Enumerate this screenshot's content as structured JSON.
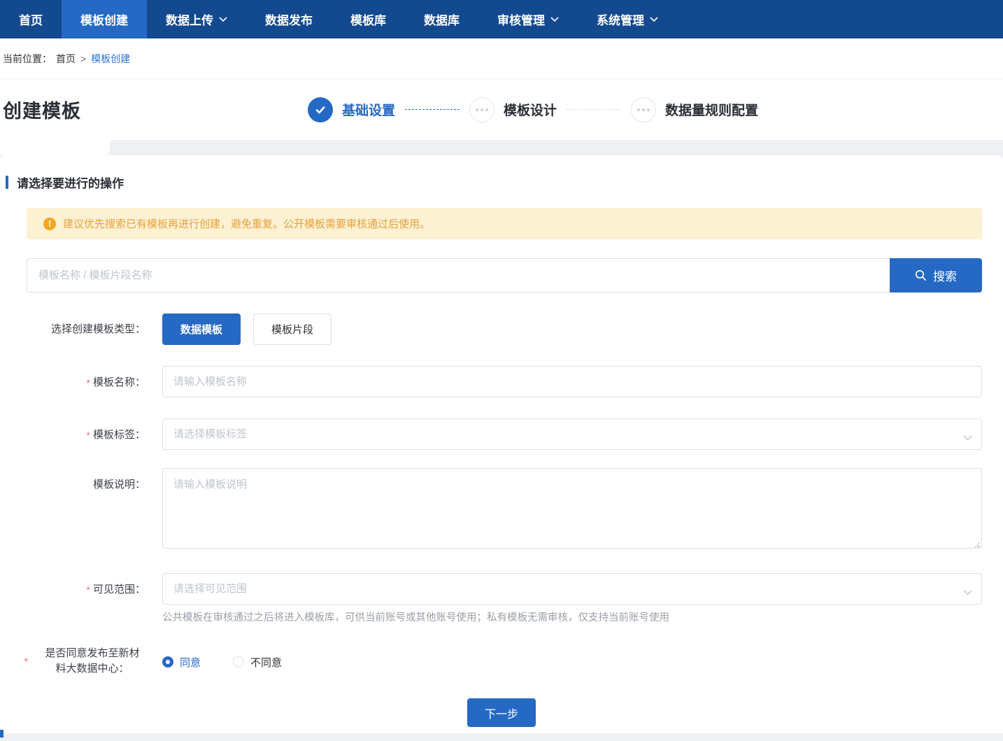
{
  "colors": {
    "nav_bg": "#13498F",
    "primary": "#2569C5",
    "link": "#2D74D4",
    "warning_bg": "#FCF1D3",
    "warning_text": "#E6A23C",
    "warning_icon": "#F5A623",
    "required": "#F56C6C"
  },
  "nav": {
    "items": [
      {
        "label": "首页",
        "active": false,
        "dropdown": false
      },
      {
        "label": "模板创建",
        "active": true,
        "dropdown": false
      },
      {
        "label": "数据上传",
        "active": false,
        "dropdown": true
      },
      {
        "label": "数据发布",
        "active": false,
        "dropdown": false
      },
      {
        "label": "模板库",
        "active": false,
        "dropdown": false
      },
      {
        "label": "数据库",
        "active": false,
        "dropdown": false
      },
      {
        "label": "审核管理",
        "active": false,
        "dropdown": true
      },
      {
        "label": "系统管理",
        "active": false,
        "dropdown": true
      }
    ]
  },
  "breadcrumb": {
    "prefix": "当前位置：",
    "home": "首页",
    "separator": ">",
    "current": "模板创建"
  },
  "header": {
    "title": "创建模板"
  },
  "stepper": {
    "steps": [
      {
        "label": "基础设置",
        "state": "active"
      },
      {
        "label": "模板设计",
        "state": "pending"
      },
      {
        "label": "数据量规则配置",
        "state": "pending"
      }
    ]
  },
  "section": {
    "title": "请选择要进行的操作"
  },
  "notice": {
    "icon": "exclamation",
    "text": "建议优先搜索已有模板再进行创建，避免重复。公开模板需要审核通过后使用。"
  },
  "search": {
    "placeholder": "模板名称 / 模板片段名称",
    "button_label": "搜索"
  },
  "type_selector": {
    "label": "选择创建模板类型：",
    "options": [
      {
        "label": "数据模板",
        "active": true
      },
      {
        "label": "模板片段",
        "active": false
      }
    ]
  },
  "form": {
    "template_name": {
      "label": "模板名称：",
      "required": "*",
      "placeholder": "请输入模板名称",
      "value": ""
    },
    "template_tag": {
      "label": "模板标签：",
      "required": "*",
      "placeholder": "请选择模板标签",
      "value": ""
    },
    "template_desc": {
      "label": "模板说明：",
      "placeholder": "请输入模板说明",
      "value": ""
    },
    "visibility": {
      "label": "可见范围：",
      "required": "*",
      "placeholder": "请选择可见范围",
      "value": "",
      "hint": "公共模板在审核通过之后将进入模板库，可供当前账号或其他账号使用；私有模板无需审核，仅支持当前账号使用"
    },
    "publish_consent": {
      "required": "*",
      "label_line1": "是否同意发布至新材",
      "label_line2": "料大数据中心：",
      "options": [
        {
          "label": "同意",
          "selected": true
        },
        {
          "label": "不同意",
          "selected": false
        }
      ]
    }
  },
  "actions": {
    "next_label": "下一步"
  }
}
